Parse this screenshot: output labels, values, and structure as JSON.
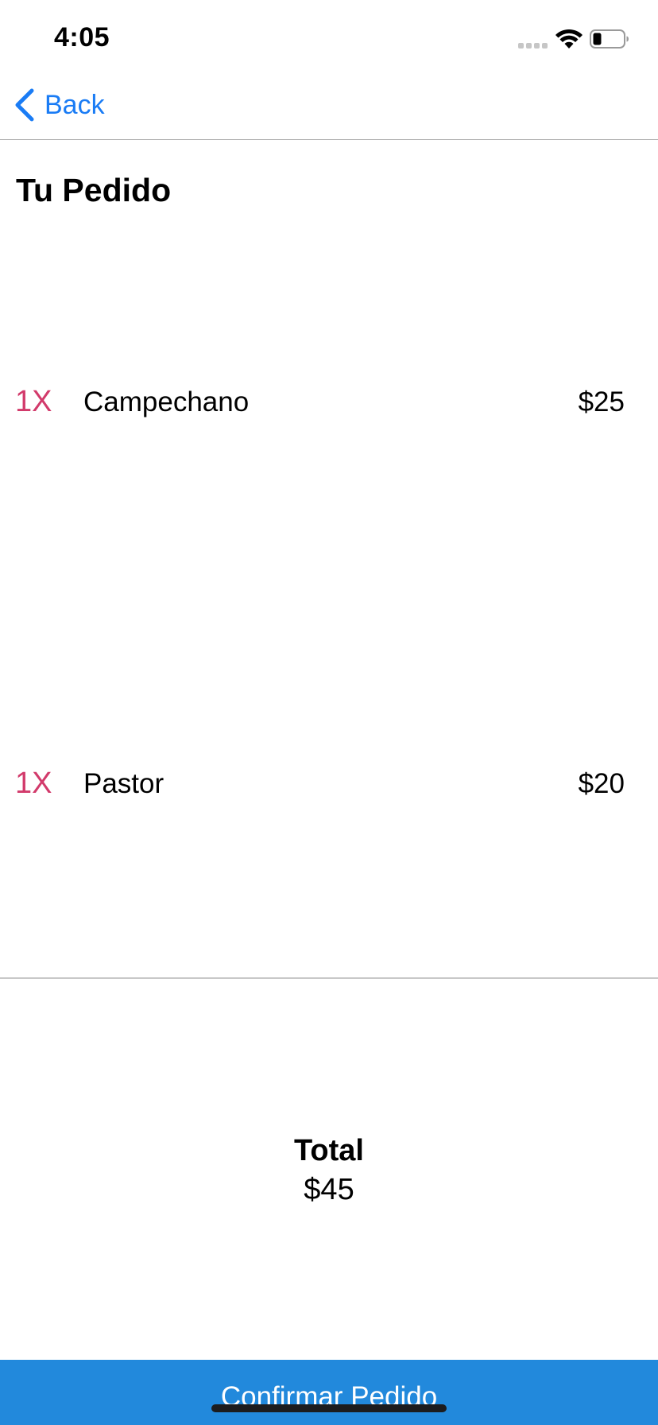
{
  "status_bar": {
    "time": "4:05"
  },
  "nav": {
    "back_label": "Back"
  },
  "page": {
    "title": "Tu Pedido"
  },
  "order": {
    "items": [
      {
        "qty": "1X",
        "name": "Campechano",
        "price": "$25"
      },
      {
        "qty": "1X",
        "name": "Pastor",
        "price": "$20"
      }
    ]
  },
  "total": {
    "label": "Total",
    "value": "$45"
  },
  "confirm": {
    "label": "Confirmar Pedido"
  },
  "colors": {
    "accent_blue": "#1a7cf5",
    "button_blue": "#2289dc",
    "qty_pink": "#d23a6b"
  },
  "icons": {
    "back": "chevron-left-icon",
    "wifi": "wifi-icon",
    "battery": "battery-icon",
    "signal": "cellular-signal-icon"
  }
}
